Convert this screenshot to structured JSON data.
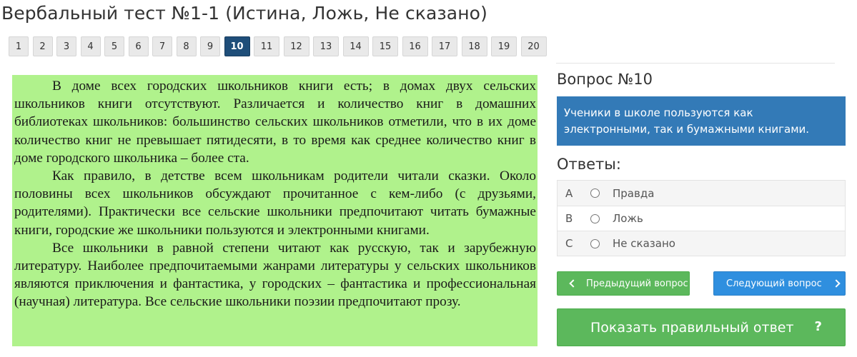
{
  "header": {
    "title": "Вербальный тест №1-1 (Истина, Ложь, Не сказано)"
  },
  "pagination": {
    "pages": [
      "1",
      "2",
      "3",
      "4",
      "5",
      "6",
      "7",
      "8",
      "9",
      "10",
      "11",
      "12",
      "13",
      "14",
      "15",
      "16",
      "17",
      "18",
      "19",
      "20"
    ],
    "active": "10"
  },
  "passage": {
    "paragraphs": [
      "В доме всех городских школьников книги есть; в домах двух сельских школьников книги отсутствуют. Различается и количество книг в домашних библиотеках школьников: большинство сельских школьников отметили, что в их доме количество книг не превышает пятидесяти, в то время как среднее количество книг в доме городского школьника – более ста.",
      "Как правило, в детстве всем школьникам родители читали сказки. Около половины всех школьников обсуждают прочитанное с кем-либо (с друзьями, родителями). Практически все сельские школьники предпочитают читать бумажные книги, городские же школьники пользуются и электронными книгами.",
      "Все школьники в равной степени читают как русскую, так и зарубежную литературу. Наиболее предпочитаемыми жанрами литературы у сельских школьников являются приключения и фантастика, у городских – фантастика и профессиональная (научная) литература. Все сельские школьники поэзии предпочитают прозу."
    ]
  },
  "question": {
    "title": "Вопрос №10",
    "text": "Ученики в школе пользуются как электронными, так и бумажными книгами."
  },
  "answers": {
    "title": "Ответы:",
    "options": [
      {
        "letter": "A",
        "text": "Правда"
      },
      {
        "letter": "B",
        "text": "Ложь"
      },
      {
        "letter": "C",
        "text": "Не сказано"
      }
    ]
  },
  "buttons": {
    "prev": "Предыдущий вопрос",
    "next": "Следующий вопрос",
    "show_answer": "Показать правильный ответ",
    "help": "?"
  },
  "colors": {
    "passage_bg": "#b0f28c",
    "active_page": "#1f4e79",
    "question_box": "#337ab7",
    "green_button": "#5cb85c",
    "blue_button": "#2f8fdf"
  },
  "icons": {
    "prev": "chevron-left-icon",
    "next": "chevron-right-icon",
    "help": "question-mark-icon"
  }
}
